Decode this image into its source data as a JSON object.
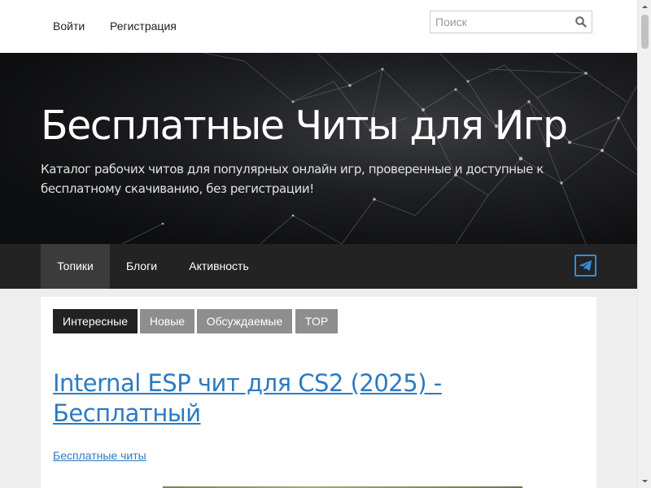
{
  "topbar": {
    "login_label": "Войти",
    "register_label": "Регистрация",
    "search": {
      "placeholder": "Поиск",
      "value": ""
    }
  },
  "hero": {
    "title": "Бесплатные Читы для Игр",
    "subtitle": "Каталог рабочих читов для популярных онлайн игр, проверенные и доступные к бесплатному скачиванию, без регистрации!"
  },
  "nav": {
    "items": [
      {
        "label": "Топики",
        "active": true
      },
      {
        "label": "Блоги",
        "active": false
      },
      {
        "label": "Активность",
        "active": false
      }
    ],
    "telegram_icon": "telegram-icon"
  },
  "feed": {
    "tabs": [
      {
        "label": "Интересные",
        "active": true
      },
      {
        "label": "Новые",
        "active": false
      },
      {
        "label": "Обсуждаемые",
        "active": false
      },
      {
        "label": "TOP",
        "active": false
      }
    ],
    "post": {
      "title": "Internal ESP чит для CS2 (2025) - Бесплатный",
      "category": "Бесплатные читы"
    }
  },
  "colors": {
    "link_blue": "#2b7bc2",
    "nav_bg": "#232323",
    "nav_active": "#3b3b3b",
    "tab_active": "#222222",
    "tab_inactive": "#8e8e8e",
    "telegram_blue": "#2f8fe0"
  }
}
